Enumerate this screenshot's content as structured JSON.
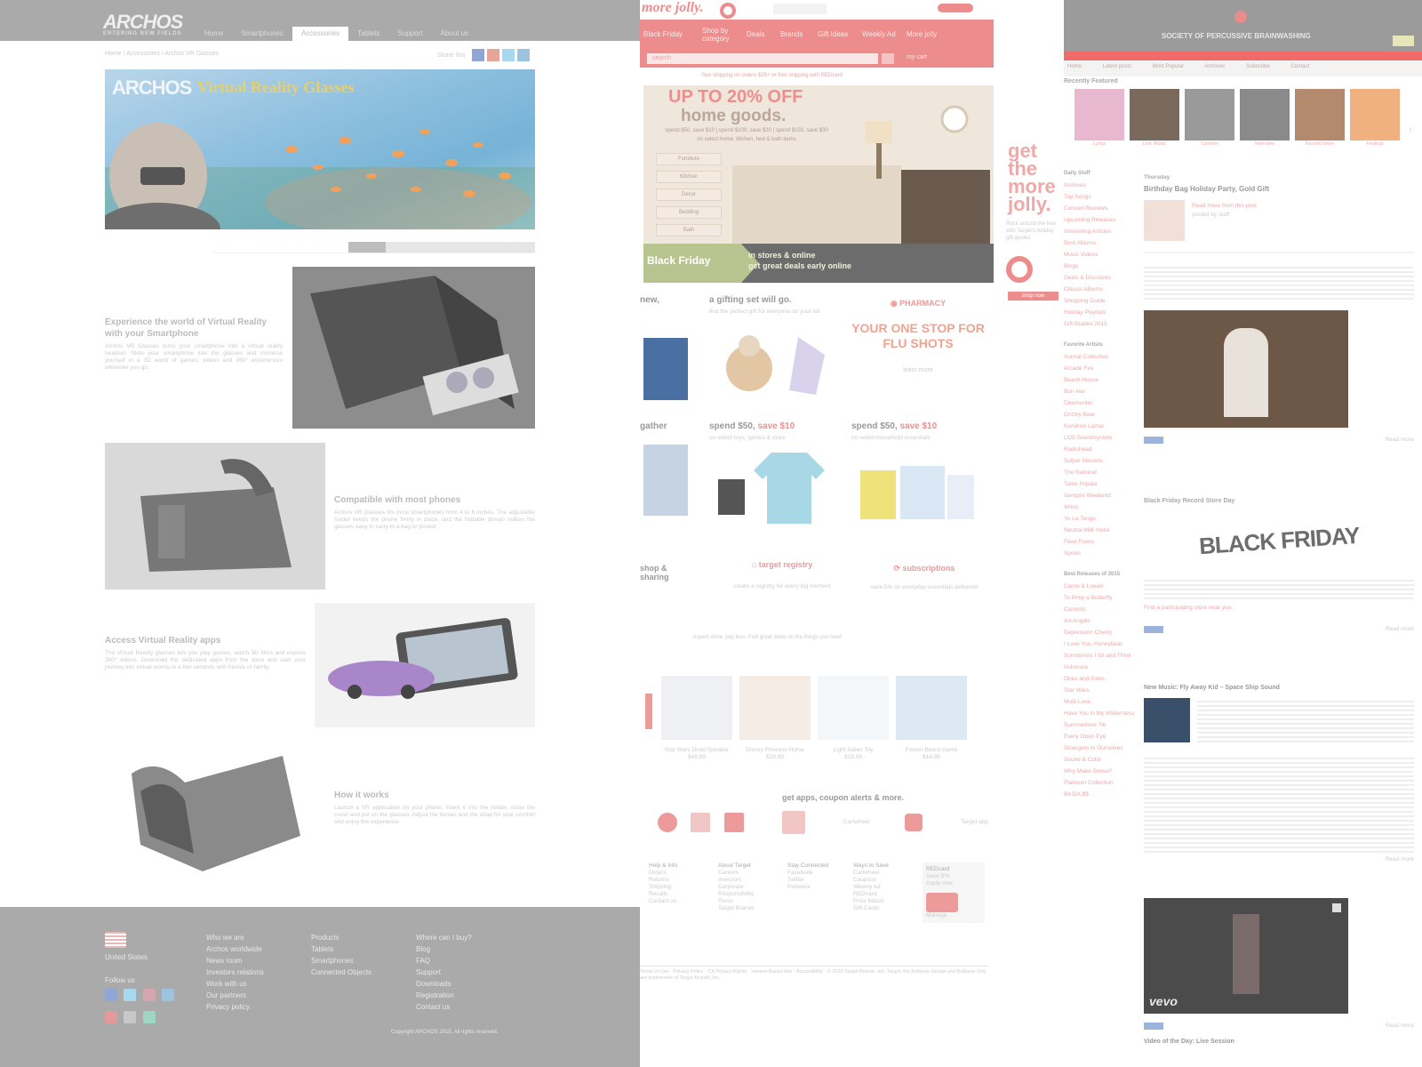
{
  "archos": {
    "logo": "ARCHOS",
    "tagline": "ENTERING NEW FIELDS",
    "nav": [
      "Home",
      "Smartphones",
      "Accessories",
      "Tablets",
      "Support",
      "About us"
    ],
    "active_nav_index": 2,
    "breadcrumb": "Home / Accessories / Archos VR Glasses",
    "share_label": "Share this",
    "hero": {
      "brand": "ARCHOS",
      "title": "Virtual Reality Glasses"
    },
    "sections": [
      {
        "title": "Experience the world of Virtual Reality with your Smartphone",
        "body": "Archos VR Glasses turns your smartphone into a virtual reality headset. Slide your smartphone into the glasses and immerse yourself in a 3D world of games, videos and 360° experiences wherever you go."
      },
      {
        "title": "Compatible with most phones",
        "body": "Archos VR Glasses fits most smartphones from 4 to 6 inches. The adjustable holder keeps the phone firmly in place, and the foldable design makes the glasses easy to carry in a bag or pocket."
      },
      {
        "title": "Access Virtual Reality apps",
        "body": "The Virtual Reality glasses lets you play games, watch 3D films and explore 360° videos. Download the dedicated apps from the store and start your journey into virtual worlds in a few seconds with friends or family."
      },
      {
        "title": "How it works",
        "body": "Launch a VR application on your phone, insert it into the holder, close the cover and put on the glasses. Adjust the lenses and the strap for your comfort and enjoy the experience."
      }
    ],
    "footer": {
      "country": "United States",
      "follow": "Follow us",
      "col1": [
        "Who we are",
        "Archos worldwide",
        "News room",
        "Investors relations",
        "Work with us",
        "Our partners",
        "Privacy policy"
      ],
      "col2": [
        "Products",
        "Tablets",
        "Smartphones",
        "Connected Objects"
      ],
      "col3": [
        "Where can I buy?",
        "Blog",
        "FAQ",
        "Support",
        "Downloads",
        "Registration",
        "Contact us"
      ],
      "copyright": "Copyright ARCHOS 2015. All rights reserved."
    },
    "colors": {
      "topbar": "#aaaaaa",
      "footer": "#aaaaaa"
    }
  },
  "target": {
    "brand": "more jolly.",
    "nav": [
      "Black Friday",
      "Shop by category",
      "Deals",
      "Brands",
      "Gift Ideas",
      "Weekly Ad",
      "More jolly"
    ],
    "search_placeholder": "search",
    "cart": "my cart",
    "free_shipping": "free shipping on orders $25+ or free shipping with REDcard",
    "promo": {
      "headline1": "UP TO 20% OFF",
      "headline2": "home goods.",
      "line": "spend $50, save $10 | spend $100, save $20 | spend $150, save $30",
      "subline": "on select home, kitchen, bed & bath items",
      "options": [
        "Furniture",
        "Kitchen",
        "Decor",
        "Bedding",
        "Bath"
      ],
      "banner1": "Black Friday",
      "banner2": "in stores & online",
      "banner3": "get great deals early online"
    },
    "side_ad": {
      "lines": [
        "get",
        "the",
        "more",
        "jolly."
      ],
      "text": "Rock around the tree with Target's holiday gift guides",
      "cta": "shop now"
    },
    "row1": [
      {
        "title": "new,",
        "sub": ""
      },
      {
        "title": "a gifting set will go.",
        "sub": "find the perfect gift for everyone on your list"
      },
      {
        "title": "PHARMACY",
        "sub": "YOUR ONE STOP FOR FLU SHOTS",
        "cta": "learn more"
      }
    ],
    "row2": [
      {
        "title": "gather",
        "em": ""
      },
      {
        "title": "spend $50, ",
        "em": "save $10",
        "sub": "on select toys, games & more"
      },
      {
        "title": "spend $50, ",
        "em": "save $10",
        "sub": "on select household essentials"
      }
    ],
    "row3": [
      {
        "title": "shop & sharing"
      },
      {
        "title": "target registry",
        "sub": "create a registry for every big moment"
      },
      {
        "title": "subscriptions",
        "sub": "save 5% on everyday essentials delivered"
      }
    ],
    "expect_more": "expect more. pay less. Find great deals on the things you need",
    "products": [
      {
        "name": "Star Wars Droid Speaker",
        "price": "$49.99"
      },
      {
        "name": "Disney Princess Horse",
        "price": "$29.99"
      },
      {
        "name": "Light Saber Toy",
        "price": "$19.99"
      },
      {
        "name": "Frozen Board Game",
        "price": "$14.99"
      }
    ],
    "apps_title": "get apps, coupon alerts & more.",
    "apps": [
      "Cartwheel",
      "Target app"
    ],
    "footer_cols": [
      {
        "title": "Help & Info",
        "items": [
          "Orders",
          "Returns",
          "Shipping",
          "Recalls",
          "Contact us"
        ]
      },
      {
        "title": "About Target",
        "items": [
          "Careers",
          "Investors",
          "Corporate",
          "Responsibility",
          "Press",
          "Target Brands"
        ]
      },
      {
        "title": "Stay Connected",
        "items": [
          "Facebook",
          "Twitter",
          "Pinterest"
        ]
      },
      {
        "title": "Ways to Save",
        "items": [
          "Cartwheel",
          "Coupons",
          "Weekly Ad",
          "REDcard",
          "Price Match",
          "Gift Cards"
        ]
      },
      {
        "title": "REDcard",
        "items": [
          "Save 5%",
          "Apply now",
          "Manage"
        ]
      }
    ],
    "legal": "Terms of Use · Privacy Policy · CA Privacy Rights · Interest Based Ads · Accessibility · © 2015 Target Brands, Inc. Target, the Bullseye Design and Bullseye Dog are trademarks of Target Brands, Inc.",
    "colors": {
      "accent": "#ec8c8c"
    }
  },
  "blog": {
    "site_title": "SOCIETY OF PERCUSSIVE BRAINWASHING",
    "subnav": [
      "Home",
      "Latest posts",
      "Most Popular",
      "Archives",
      "Subscribe",
      "Contact"
    ],
    "featured_title": "Recently Featured",
    "thumbs": [
      "Lyrics",
      "Live Music",
      "Concert",
      "Interview",
      "Record Store",
      "Festival"
    ],
    "sidebar_sections": [
      {
        "title": "Daily Stuff",
        "items": [
          "Archives",
          "Top Songs",
          "Concert Reviews",
          "Upcoming Releases",
          "Interesting Articles",
          "Best Albums",
          "Music Videos",
          "Blogs",
          "Deals & Discounts",
          "Classic Albums",
          "Shopping Guide",
          "Holiday Playlists",
          "Gift Guides 2015"
        ]
      },
      {
        "title": "Favorite Artists",
        "items": [
          "Animal Collective",
          "Arcade Fire",
          "Beach House",
          "Bon Iver",
          "Deerhunter",
          "Grizzly Bear",
          "Kendrick Lamar",
          "LCD Soundsystem",
          "Radiohead",
          "Sufjan Stevens",
          "The National",
          "Tame Impala",
          "Vampire Weekend",
          "Wilco",
          "Yo La Tengo",
          "Neutral Milk Hotel",
          "Fleet Foxes",
          "Spoon"
        ]
      },
      {
        "title": "Best Releases of 2015",
        "items": [
          "Carrie & Lowell",
          "To Pimp a Butterfly",
          "Currents",
          "Art Angels",
          "Depression Cherry",
          "I Love You, Honeybear",
          "Sometimes I Sit and Think",
          "Vulnicura",
          "Ones and Sixes",
          "Star Wars",
          "Multi-Love",
          "Have You in My Wilderness",
          "Summertime '06",
          "Every Open Eye",
          "Strangers to Ourselves",
          "Sound & Color",
          "Why Make Sense?",
          "Platinum Collection",
          "B4.DA.$$"
        ]
      }
    ],
    "posts": [
      {
        "date": "Thursday",
        "title": "Birthday Bag Holiday Party, Gold Gift",
        "meta": "posted by staff",
        "link": "Read more from this post",
        "read_more": "Read more"
      },
      {
        "title": "Black Friday Record Store Day",
        "link": "Find a participating store near you",
        "read_more": "Read more"
      },
      {
        "title": "New Music: Fly Away Kid – Space Ship Sound",
        "read_more": "Read more"
      },
      {
        "title": "Video of the Day: Live Session",
        "read_more": "Read more"
      }
    ],
    "black_friday_banner": "BLACK FRIDAY",
    "video_label": "vevo",
    "colors": {
      "topbar": "#9b9b9b",
      "accent": "#f06a6a"
    }
  }
}
